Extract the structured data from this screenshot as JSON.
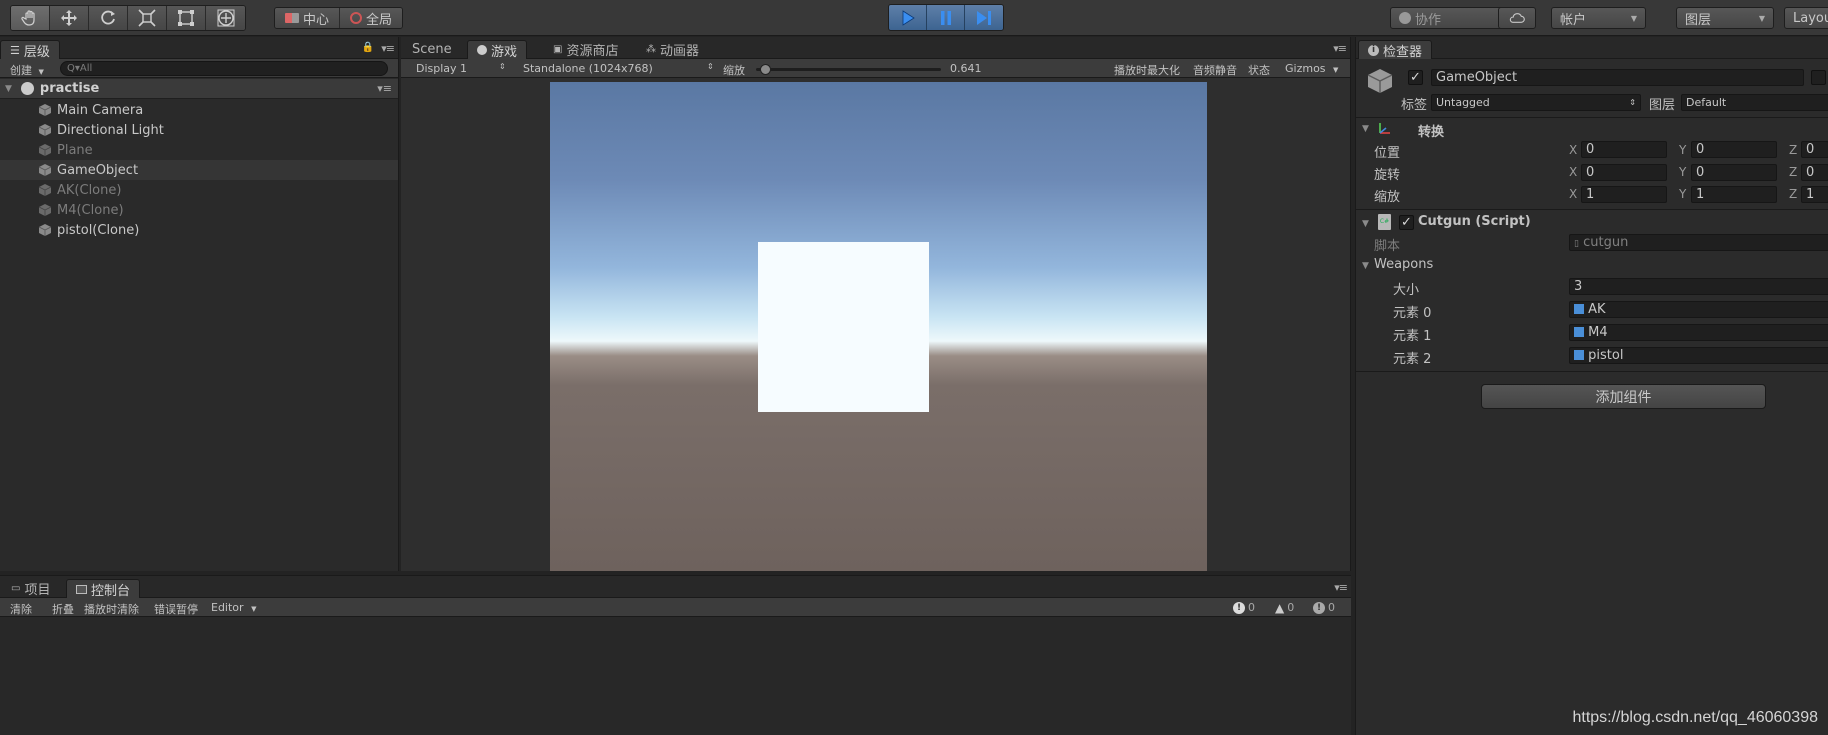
{
  "toolbar": {
    "tools": [
      "hand-icon",
      "move-icon",
      "rotate-icon",
      "scale-icon",
      "rect-icon",
      "transform-icon"
    ],
    "pivot_label": "中心",
    "global_label": "全局",
    "collab_label": "协作",
    "account_label": "帐户",
    "layers_label": "图层",
    "layout_label": "Layout",
    "play_color": "#3d6491"
  },
  "hierarchy": {
    "tab_label": "层级",
    "create_label": "创建",
    "search_placeholder": "Q▾All",
    "scene_name": "practise",
    "items": [
      {
        "label": "Main Camera"
      },
      {
        "label": "Directional Light"
      },
      {
        "label": "Plane"
      },
      {
        "label": "GameObject"
      },
      {
        "label": "AK(Clone)"
      },
      {
        "label": "M4(Clone)"
      },
      {
        "label": "pistol(Clone)"
      }
    ]
  },
  "game": {
    "tabs": {
      "scene": "Scene",
      "game": "游戏",
      "store": "资源商店",
      "animator": "动画器"
    },
    "display": "Display 1",
    "resolution": "Standalone (1024x768)",
    "scale_label": "缩放",
    "scale_value": "0.641",
    "scale_fraction": 0.02,
    "maximize": "播放时最大化",
    "mute": "音频静音",
    "stats": "状态",
    "gizmos": "Gizmos"
  },
  "inspector": {
    "tab_label": "检查器",
    "object_name": "GameObject",
    "tag_label": "标签",
    "tag_value": "Untagged",
    "layer_label": "图层",
    "layer_value": "Default",
    "transform": {
      "title": "转换",
      "position_label": "位置",
      "rotation_label": "旋转",
      "scale_label": "缩放",
      "position": {
        "x": "0",
        "y": "0",
        "z": "0"
      },
      "rotation": {
        "x": "0",
        "y": "0",
        "z": "0"
      },
      "scale": {
        "x": "1",
        "y": "1",
        "z": "1"
      }
    },
    "script": {
      "title": "Cutgun (Script)",
      "script_label": "脚本",
      "script_value": "cutgun",
      "weapons_label": "Weapons",
      "size_label": "大小",
      "size_value": "3",
      "elements": [
        {
          "label": "元素 0",
          "value": "AK"
        },
        {
          "label": "元素 1",
          "value": "M4"
        },
        {
          "label": "元素 2",
          "value": "pistol"
        }
      ]
    },
    "add_component": "添加组件"
  },
  "console": {
    "project_tab": "项目",
    "console_tab": "控制台",
    "clear": "清除",
    "collapse": "折叠",
    "clear_on_play": "播放时清除",
    "error_pause": "错误暂停",
    "editor": "Editor",
    "errors": "0",
    "warnings": "0",
    "logs": "0"
  },
  "watermark": "https://blog.csdn.net/qq_46060398"
}
